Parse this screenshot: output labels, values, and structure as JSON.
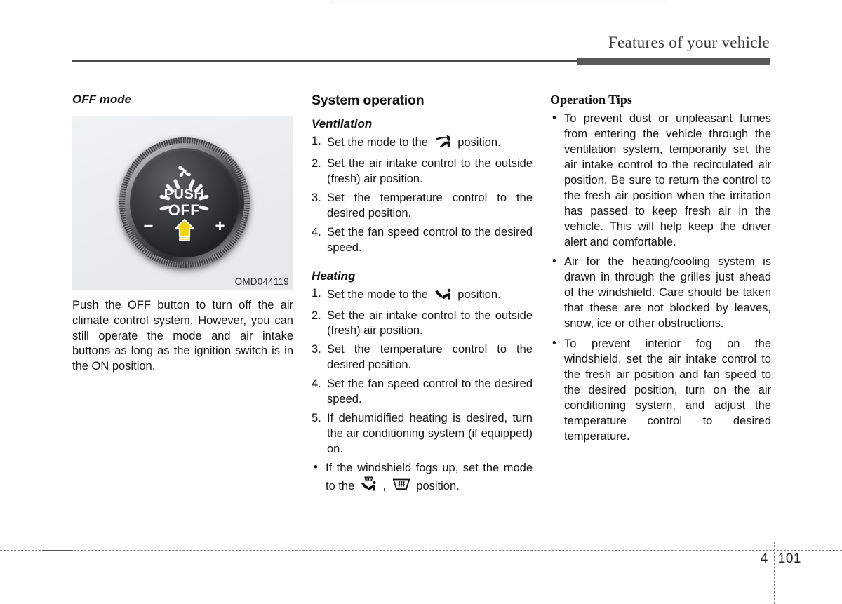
{
  "header": {
    "title": "Features of your vehicle"
  },
  "footer": {
    "chapter": "4",
    "page": "101"
  },
  "left_column": {
    "heading": "OFF mode",
    "figure": {
      "caption": "OMD044119",
      "knob": {
        "push_label": "PUSH",
        "off_label": "OFF",
        "minus": "−",
        "plus": "+",
        "fan_icon": "fan-icon",
        "arrow_icon": "push-arrow-icon"
      }
    },
    "paragraph": "Push the OFF button to turn off the air climate control system. However, you can still operate the mode and air intake buttons as long as the ignition switch is in the ON position."
  },
  "middle_column": {
    "heading": "System operation",
    "ventilation": {
      "title": "Ventilation",
      "steps": [
        {
          "num": "1.",
          "before": "Set the mode to the",
          "icon": "face-vent-icon",
          "after": "position."
        },
        {
          "num": "2.",
          "text": "Set the air intake control to the outside (fresh) air position."
        },
        {
          "num": "3.",
          "text": "Set the temperature control to the desired position."
        },
        {
          "num": "4.",
          "text": "Set the fan speed control to the desired speed."
        }
      ]
    },
    "heating": {
      "title": "Heating",
      "steps": [
        {
          "num": "1.",
          "before": "Set the mode to the",
          "icon": "floor-vent-icon",
          "after": "position."
        },
        {
          "num": "2.",
          "text": "Set the air intake control to the outside (fresh) air position."
        },
        {
          "num": "3.",
          "text": "Set the temperature control to the desired position."
        },
        {
          "num": "4.",
          "text": "Set the fan speed control to the desired speed."
        },
        {
          "num": "5.",
          "text": "If dehumidified heating is desired, turn the air conditioning system (if equipped) on."
        }
      ],
      "bullet": {
        "dot": "•",
        "before": "If the windshield fogs up, set the mode to the",
        "icon1": "floor-defrost-icon",
        "separator": ",",
        "icon2": "defrost-icon",
        "after": "position."
      }
    }
  },
  "right_column": {
    "heading": "Operation Tips",
    "bullets": [
      {
        "dot": "•",
        "text": "To prevent dust or unpleasant fumes from entering the vehicle through the ventilation system, temporarily set the air intake control to the recirculated air position. Be sure to return the control to the fresh air position when the irritation has passed to keep fresh air in the vehicle. This will help keep the driver alert and comfortable."
      },
      {
        "dot": "•",
        "text": "Air for the heating/cooling system is drawn in through the grilles just ahead of the windshield. Care should be taken that these are not blocked by leaves, snow, ice or other obstructions."
      },
      {
        "dot": "•",
        "text": "To prevent interior fog on the windshield, set the air intake control to the fresh air position and fan speed to the desired position, turn on the air conditioning system, and adjust the temperature control to desired temperature."
      }
    ]
  },
  "colors": {
    "rule": "#4d4d4d",
    "header_text": "#3a3a3a",
    "figure_background": "#eceef0",
    "knob_arrow": "#f5d800",
    "body_text": "#141414"
  }
}
